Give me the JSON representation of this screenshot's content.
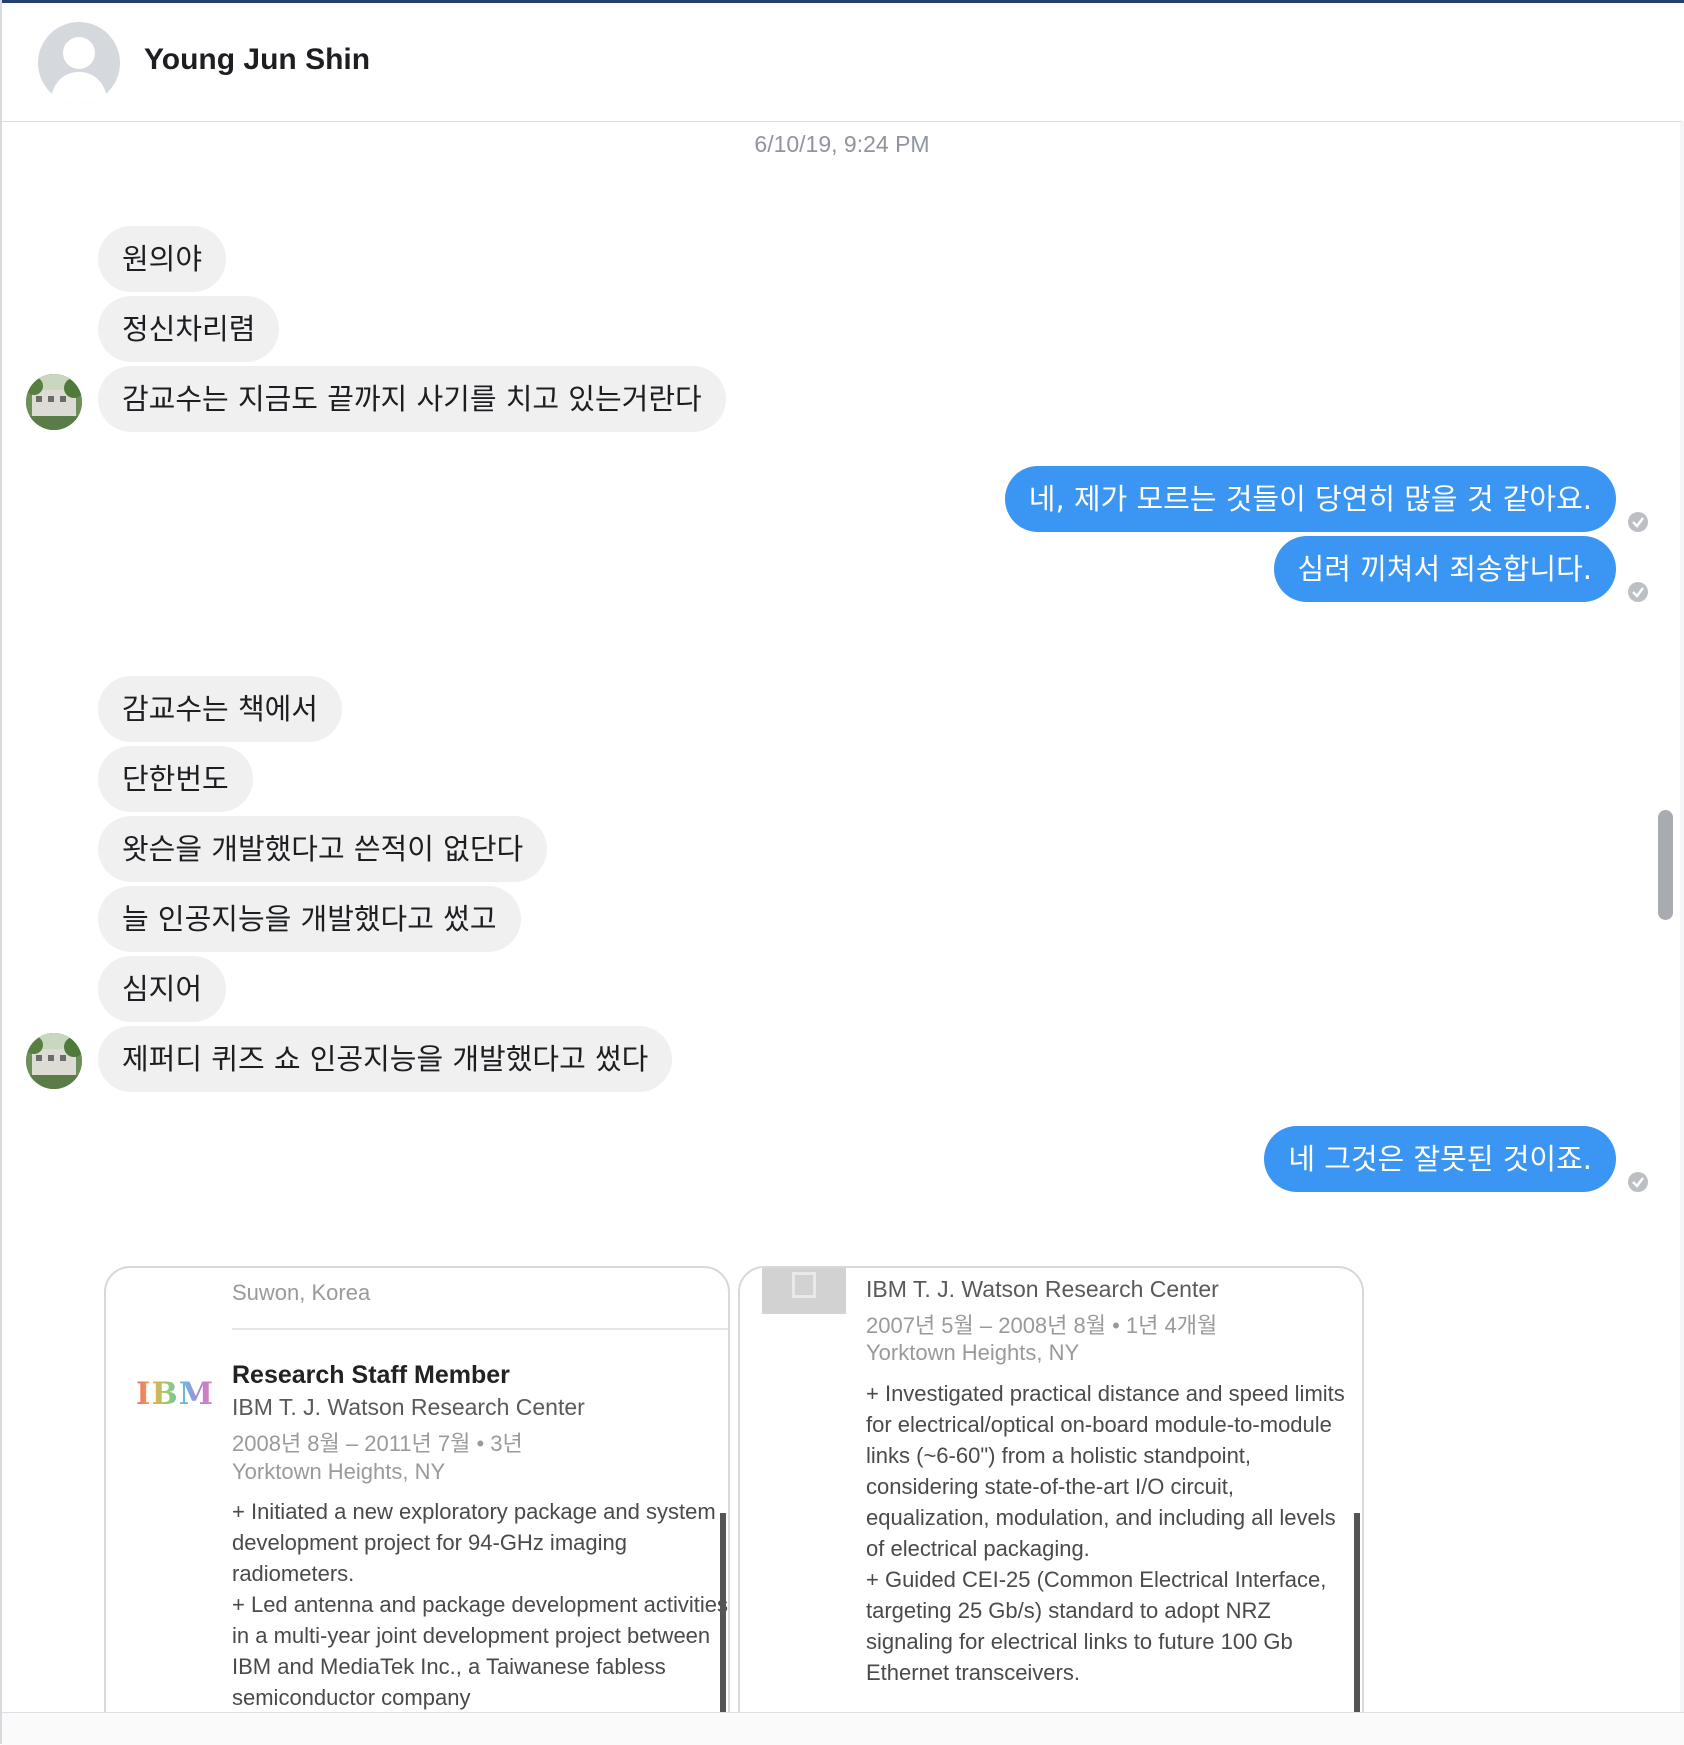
{
  "header": {
    "contact_name": "Young Jun Shin"
  },
  "timestamp": "6/10/19, 9:24 PM",
  "messages_group1_in": [
    "원의야",
    "정신차리렴",
    "감교수는 지금도 끝까지 사기를 치고 있는거란다"
  ],
  "messages_group1_out": [
    "네, 제가 모르는 것들이 당연히 많을 것 같아요.",
    "심려 끼쳐서 죄송합니다."
  ],
  "messages_group2_in": [
    "감교수는 책에서",
    "단한번도",
    "왓슨을 개발했다고 쓴적이 없단다",
    "늘 인공지능을 개발했다고 썼고",
    "심지어",
    "제퍼디 퀴즈 쇼 인공지능을 개발했다고 썼다"
  ],
  "messages_group2_out": [
    "네 그것은 잘못된 것이죠."
  ],
  "attachment": {
    "left_card": {
      "location_top": "Suwon, Korea",
      "logo_text": "IBM",
      "role": "Research Staff Member",
      "org": "IBM T. J. Watson Research Center",
      "dates": "2008년 8월 – 2011년 7월 • 3년",
      "location": "Yorktown Heights, NY",
      "description": "+ Initiated a new exploratory package and system development project for 94-GHz imaging radiometers.\n+ Led antenna and package development activities in a multi-year joint development project between IBM and MediaTek Inc., a Taiwanese fabless semiconductor company"
    },
    "right_card": {
      "org": "IBM T. J. Watson Research Center",
      "dates": "2007년 5월 – 2008년 8월 • 1년 4개월",
      "location": "Yorktown Heights, NY",
      "description": "+ Investigated practical distance and speed limits for electrical/optical on-board module-to-module links (~6-60\") from a holistic standpoint, considering state-of-the-art I/O circuit, equalization, modulation, and including all levels of electrical packaging.\n+ Guided CEI-25 (Common Electrical Interface, targeting 25 Gb/s) standard to adopt NRZ signaling for electrical links to future 100 Gb Ethernet transceivers."
    }
  },
  "colors": {
    "outgoing_bubble": "#3a96f2",
    "incoming_bubble": "#f1f0f0",
    "header_rule": "#23406e"
  },
  "icons": [
    "default-avatar-icon",
    "sender-avatar-photo",
    "seen-check-icon"
  ]
}
